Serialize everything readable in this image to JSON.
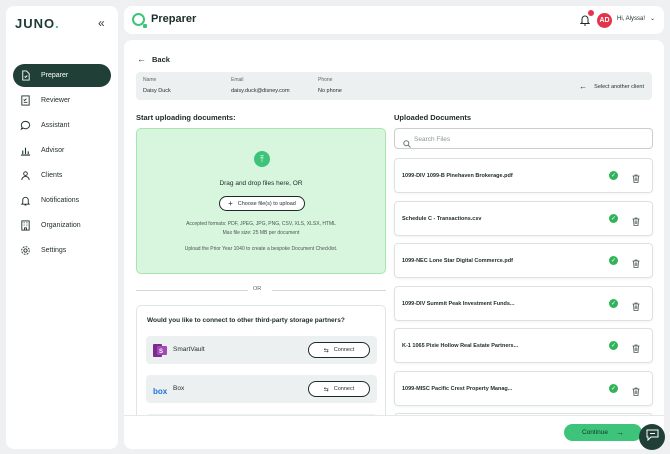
{
  "app": {
    "logo": "JUNO",
    "logo_dot": "."
  },
  "sidebar": {
    "items": [
      {
        "label": "Preparer",
        "icon": "document-icon",
        "active": true
      },
      {
        "label": "Reviewer",
        "icon": "checklist-icon"
      },
      {
        "label": "Assistant",
        "icon": "chat-icon"
      },
      {
        "label": "Advisor",
        "icon": "chart-icon"
      },
      {
        "label": "Clients",
        "icon": "clients-icon"
      },
      {
        "label": "Notifications",
        "icon": "bell-icon"
      },
      {
        "label": "Organization",
        "icon": "building-icon"
      },
      {
        "label": "Settings",
        "icon": "gear-icon"
      }
    ]
  },
  "header": {
    "title": "Preparer",
    "avatar_initials": "AD",
    "greeting": "Hi, Alyssa!"
  },
  "back_label": "Back",
  "client": {
    "name_label": "Name",
    "name": "Daisy Duck",
    "email_label": "Email",
    "email": "daisy.duck@disney.com",
    "phone_label": "Phone",
    "phone": "No phone",
    "select_another": "Select another client"
  },
  "upload": {
    "title": "Start uploading documents:",
    "drag_text": "Drag and drop files here, OR",
    "choose_label": "Choose file(s) to upload",
    "formats": "Accepted formats: PDF, JPEG, JPG, PNG, CSV, XLS, XLSX, HTML",
    "max_size": "Max file size: 25 MB per document",
    "hint": "Upload the Prior Year 1040 to create a bespoke Document Checklist.",
    "or": "OR"
  },
  "partners": {
    "question": "Would you like to connect to other third-party storage partners?",
    "items": [
      {
        "name": "SmartVault",
        "connect": "Connect"
      },
      {
        "name": "Box",
        "connect": "Connect"
      }
    ]
  },
  "uploaded": {
    "title": "Uploaded Documents",
    "search_placeholder": "Search Files",
    "files": [
      "1099-DIV 1099-B Pinehaven Brokerage.pdf",
      "Schedule C - Transactions.csv",
      "1099-NEC Lone Star Digital Commerce.pdf",
      "1099-DIV Summit Peak Investment Funds...",
      "K-1 1065 Pixie Hollow Real Estate Partners...",
      "1099-MISC Pacific Crest Property Manag..."
    ]
  },
  "continue_label": "Continue",
  "colors": {
    "accent": "#3ec47a",
    "nav_active": "#1f3f37",
    "badge": "#e3344c"
  }
}
